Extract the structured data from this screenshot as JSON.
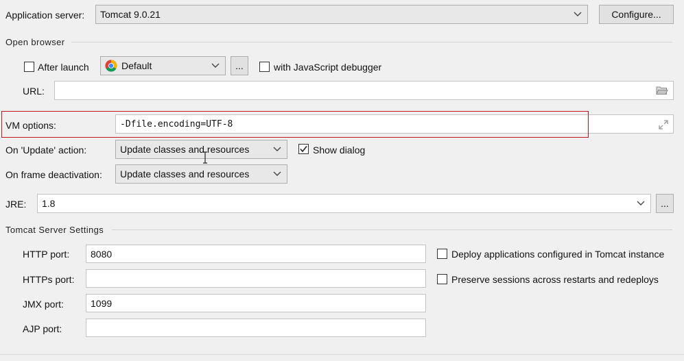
{
  "app_server": {
    "label": "Application server:",
    "value": "Tomcat 9.0.21",
    "configure_label": "Configure..."
  },
  "open_browser": {
    "title": "Open browser",
    "after_launch_label": "After launch",
    "after_launch_checked": false,
    "browser_value": "Default",
    "browse_label": "...",
    "js_debugger_label": "with JavaScript debugger",
    "js_debugger_checked": false,
    "url_label": "URL:",
    "url_value": ""
  },
  "vm_options": {
    "label": "VM options:",
    "value": "-Dfile.encoding=UTF-8"
  },
  "update_action": {
    "label": "On 'Update' action:",
    "value": "Update classes and resources",
    "show_dialog_label": "Show dialog",
    "show_dialog_checked": true
  },
  "frame_deactivation": {
    "label": "On frame deactivation:",
    "value": "Update classes and resources"
  },
  "jre": {
    "label": "JRE:",
    "value": "1.8",
    "browse_label": "..."
  },
  "tomcat_settings": {
    "title": "Tomcat Server Settings",
    "http_port_label": "HTTP port:",
    "http_port_value": "8080",
    "https_port_label": "HTTPs port:",
    "https_port_value": "",
    "jmx_port_label": "JMX port:",
    "jmx_port_value": "1099",
    "ajp_port_label": "AJP port:",
    "ajp_port_value": "",
    "deploy_label": "Deploy applications configured in Tomcat instance",
    "deploy_checked": false,
    "preserve_label": "Preserve sessions across restarts and redeploys",
    "preserve_checked": false
  },
  "colors": {
    "highlight_border": "#c0151c",
    "background": "#f0f0f0"
  },
  "icons": [
    "chevron-down-icon",
    "chrome-icon",
    "folder-icon",
    "expand-icon",
    "checkmark-icon",
    "text-cursor-icon"
  ]
}
